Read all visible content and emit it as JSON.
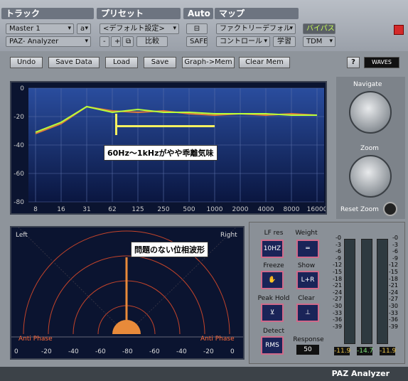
{
  "header": {
    "track": "トラック",
    "preset": "プリセット",
    "auto": "Auto",
    "map": "マップ"
  },
  "track": {
    "name": "Master 1",
    "channel": "a",
    "plugin": "PAZ- Analyzer"
  },
  "preset": {
    "value": "<デフォルト設定>",
    "minus": "-",
    "plus": "+",
    "compare": "比較"
  },
  "auto": {
    "safe": "SAFE"
  },
  "map": {
    "value": "ファクトリーデフォル",
    "control": "コントロール",
    "learn": "学習"
  },
  "bypass": "バイパス",
  "format": "TDM",
  "toolbar": {
    "undo": "Undo",
    "save_data": "Save Data",
    "load": "Load",
    "save": "Save",
    "graph_mem": "Graph->Mem",
    "clear_mem": "Clear Mem",
    "help": "?",
    "brand": "WAVES"
  },
  "navigate": {
    "title": "Navigate",
    "zoom": "Zoom",
    "reset": "Reset Zoom"
  },
  "spectrum": {
    "y_ticks": [
      "0",
      "-20",
      "-40",
      "-60",
      "-80"
    ],
    "x_ticks": [
      "8",
      "16",
      "31",
      "62",
      "125",
      "250",
      "500",
      "1000",
      "2000",
      "4000",
      "8000",
      "16000"
    ],
    "annotation": "60Hz～1kHzがやや乖離気味"
  },
  "chart_data": {
    "type": "line",
    "xlabel": "",
    "ylabel": "",
    "ylim": [
      -80,
      0
    ],
    "x": [
      8,
      16,
      31,
      62,
      125,
      250,
      500,
      1000,
      2000,
      4000,
      8000,
      16000
    ],
    "series": [
      {
        "values": [
          -32,
          -25,
          -13,
          -16,
          -17,
          -16,
          -18,
          -19,
          -18,
          -19,
          -18,
          -19
        ]
      },
      {
        "values": [
          -31,
          -24,
          -13,
          -17,
          -15,
          -17,
          -17,
          -18,
          -18,
          -18,
          -19,
          -19
        ]
      }
    ]
  },
  "phase": {
    "left": "Left",
    "right": "Right",
    "anti_left": "Anti Phase",
    "anti_right": "Anti Phase",
    "annotation": "問題のない位相波形",
    "x_ticks": [
      "0",
      "-20",
      "-40",
      "-60",
      "-80",
      "-60",
      "-40",
      "-20",
      "0"
    ]
  },
  "controls": {
    "lf_res": "LF res",
    "lf_val": "10HZ",
    "weight": "Weight",
    "freeze": "Freeze",
    "show": "Show",
    "show_val": "L+R",
    "peak_hold": "Peak Hold",
    "clear": "Clear",
    "detect": "Detect",
    "detect_val": "RMS",
    "response": "Response",
    "response_val": "50"
  },
  "meters": {
    "scale": [
      "-0",
      "-3",
      "-6",
      "-9",
      "-12",
      "-15",
      "-18",
      "-21",
      "-24",
      "-27",
      "-30",
      "-33",
      "-36",
      "-39"
    ],
    "left": "-11.9",
    "center": "-14.7",
    "right": "-11.9"
  },
  "footer": "PAZ Analyzer"
}
